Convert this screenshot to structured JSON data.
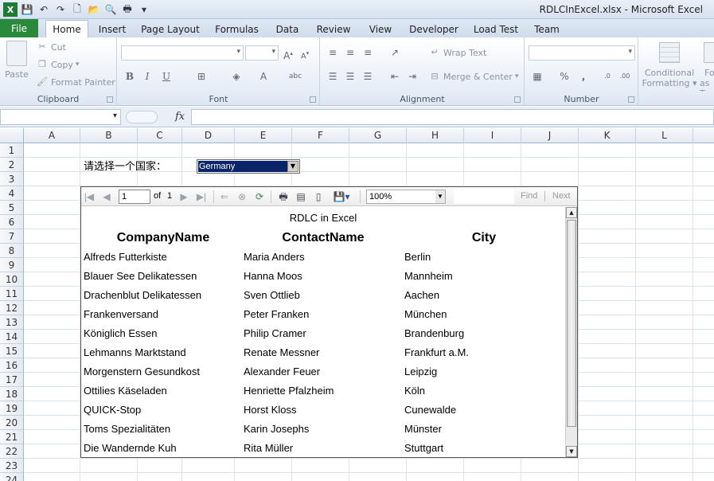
{
  "window": {
    "title": "RDLCInExcel.xlsx  -  Microsoft Excel"
  },
  "quick_access": [
    {
      "name": "excel-logo-icon",
      "glyph": "X"
    },
    {
      "name": "save-icon",
      "glyph": "💾"
    },
    {
      "name": "undo-icon",
      "glyph": "↶"
    },
    {
      "name": "redo-icon",
      "glyph": "↷"
    },
    {
      "name": "new-file-icon",
      "glyph": "🗋"
    },
    {
      "name": "open-folder-icon",
      "glyph": "📂"
    },
    {
      "name": "print-preview-icon",
      "glyph": "🔍"
    },
    {
      "name": "print-icon",
      "glyph": "🖶"
    },
    {
      "name": "customize-qat-icon",
      "glyph": "▾"
    }
  ],
  "tabs": {
    "file": "File",
    "items": [
      "Home",
      "Insert",
      "Page Layout",
      "Formulas",
      "Data",
      "Review",
      "View",
      "Developer",
      "Load Test",
      "Team"
    ],
    "active": "Home"
  },
  "ribbon": {
    "clipboard": {
      "label": "Clipboard",
      "paste": "Paste",
      "cut": "Cut",
      "copy": "Copy",
      "format_painter": "Format Painter"
    },
    "font": {
      "label": "Font",
      "bold": "B",
      "italic": "I",
      "underline": "U"
    },
    "alignment": {
      "label": "Alignment",
      "wrap_text": "Wrap Text",
      "merge_center": "Merge & Center"
    },
    "number": {
      "label": "Number",
      "percent": "%",
      "comma": ","
    },
    "styles": {
      "conditional_formatting_1": "Conditional",
      "conditional_formatting_2": "Formatting",
      "format_table_1": "Fo",
      "format_table_2": "as T"
    }
  },
  "formula_bar": {
    "fx": "fx",
    "value": ""
  },
  "columns": [
    "A",
    "B",
    "C",
    "D",
    "E",
    "F",
    "G",
    "H",
    "I",
    "J",
    "K",
    "L"
  ],
  "rows": [
    "1",
    "2",
    "3",
    "4",
    "5",
    "6",
    "7",
    "8",
    "9",
    "10",
    "11",
    "12",
    "13",
    "14",
    "15",
    "16",
    "17",
    "18",
    "19",
    "20",
    "21",
    "22",
    "23",
    "24"
  ],
  "sheet": {
    "prompt": "请选择一个国家：",
    "country_selected": "Germany"
  },
  "report_viewer": {
    "page_current": "1",
    "page_of": "of",
    "page_total": "1",
    "zoom": "100%",
    "find": "Find",
    "next": "Next",
    "title": "RDLC in Excel",
    "headers": [
      "CompanyName",
      "ContactName",
      "City"
    ],
    "rows": [
      [
        "Alfreds Futterkiste",
        "Maria Anders",
        "Berlin"
      ],
      [
        "Blauer See Delikatessen",
        "Hanna Moos",
        "Mannheim"
      ],
      [
        "Drachenblut Delikatessen",
        "Sven Ottlieb",
        "Aachen"
      ],
      [
        "Frankenversand",
        "Peter Franken",
        "München"
      ],
      [
        "Königlich Essen",
        "Philip Cramer",
        "Brandenburg"
      ],
      [
        "Lehmanns Marktstand",
        "Renate Messner",
        "Frankfurt a.M."
      ],
      [
        "Morgenstern Gesundkost",
        "Alexander Feuer",
        "Leipzig"
      ],
      [
        "Ottilies Käseladen",
        "Henriette Pfalzheim",
        "Köln"
      ],
      [
        "QUICK-Stop",
        "Horst Kloss",
        "Cunewalde"
      ],
      [
        "Toms Spezialitäten",
        "Karin Josephs",
        "Münster"
      ],
      [
        "Die Wandernde Kuh",
        "Rita Müller",
        "Stuttgart"
      ]
    ]
  }
}
